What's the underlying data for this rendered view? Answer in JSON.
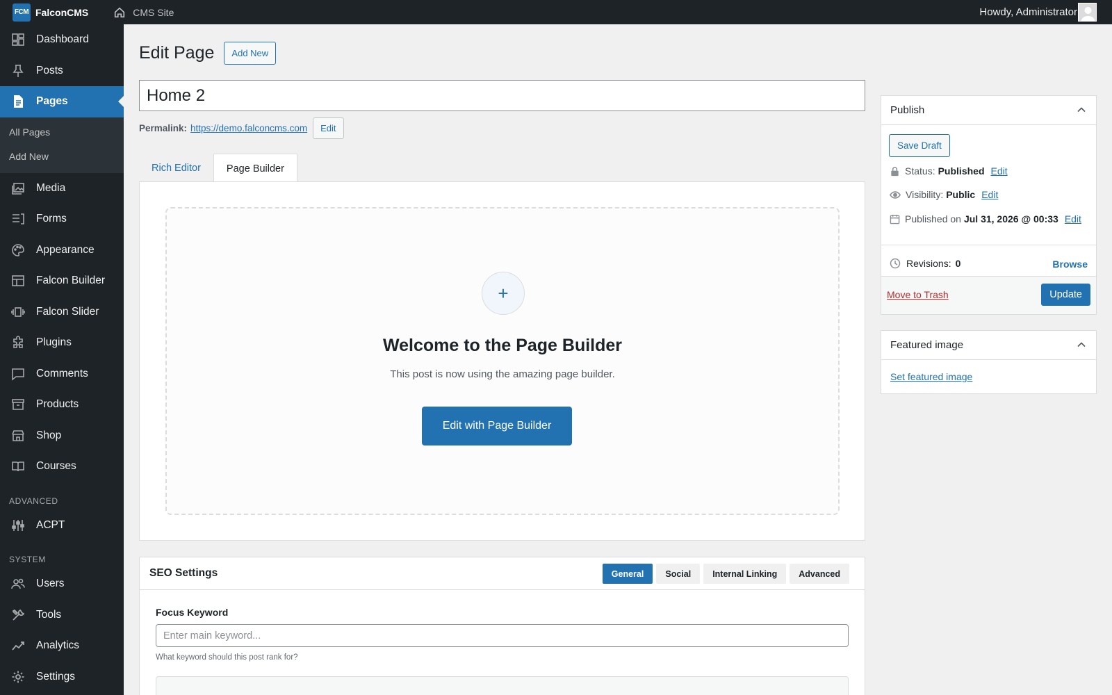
{
  "topbar": {
    "logo_text": "FCM",
    "brand": "FalconCMS",
    "site_label": "CMS Site",
    "howdy_prefix": "Howdy,",
    "user_name": "Administrator"
  },
  "sidebar": {
    "items": [
      {
        "label": "Dashboard",
        "icon": "dashboard-icon"
      },
      {
        "label": "Posts",
        "icon": "pin-icon"
      },
      {
        "label": "Pages",
        "icon": "page-icon",
        "active": true
      },
      {
        "label": "Media",
        "icon": "media-icon"
      },
      {
        "label": "Forms",
        "icon": "forms-icon"
      },
      {
        "label": "Appearance",
        "icon": "palette-icon"
      },
      {
        "label": "Falcon Builder",
        "icon": "layout-icon"
      },
      {
        "label": "Falcon Slider",
        "icon": "slider-icon"
      },
      {
        "label": "Plugins",
        "icon": "plugin-icon"
      },
      {
        "label": "Comments",
        "icon": "comment-icon"
      },
      {
        "label": "Products",
        "icon": "archive-icon"
      },
      {
        "label": "Shop",
        "icon": "store-icon"
      },
      {
        "label": "Courses",
        "icon": "book-icon"
      }
    ],
    "submenu": [
      "All Pages",
      "Add New"
    ],
    "section_advanced": "ADVANCED",
    "advanced_items": [
      {
        "label": "ACPT",
        "icon": "sliders-icon"
      }
    ],
    "section_system": "SYSTEM",
    "system_items": [
      {
        "label": "Users",
        "icon": "users-icon"
      },
      {
        "label": "Tools",
        "icon": "tools-icon"
      },
      {
        "label": "Analytics",
        "icon": "chart-icon"
      },
      {
        "label": "Settings",
        "icon": "gear-icon"
      }
    ]
  },
  "main": {
    "page_title": "Edit Page",
    "add_new": "Add New",
    "post_title": "Home 2",
    "permalink_label": "Permalink:",
    "permalink_url": "https://demo.falconcms.com",
    "permalink_edit": "Edit",
    "tabs": [
      "Rich Editor",
      "Page Builder"
    ],
    "active_tab": "Page Builder",
    "builder": {
      "plus": "+",
      "title": "Welcome to the Page Builder",
      "subtitle": "This post is now using the amazing page builder.",
      "button": "Edit with Page Builder"
    },
    "seo": {
      "title": "SEO Settings",
      "tabs": [
        "General",
        "Social",
        "Internal Linking",
        "Advanced"
      ],
      "active_tab": "General",
      "focus_label": "Focus Keyword",
      "focus_placeholder": "Enter main keyword...",
      "focus_help": "What keyword should this post rank for?"
    }
  },
  "publish": {
    "title": "Publish",
    "save_draft": "Save Draft",
    "status_label": "Status:",
    "status_value": "Published",
    "visibility_label": "Visibility:",
    "visibility_value": "Public",
    "published_label": "Published on",
    "published_value": "Jul 31, 2026 @ 00:33",
    "edit": "Edit",
    "revisions_label": "Revisions:",
    "revisions_value": "0",
    "browse": "Browse",
    "trash": "Move to Trash",
    "update": "Update"
  },
  "featured": {
    "title": "Featured image",
    "link": "Set featured image"
  },
  "colors": {
    "accent": "#2271b1",
    "sidebar_bg": "#1d2327",
    "danger": "#b32d2e"
  }
}
